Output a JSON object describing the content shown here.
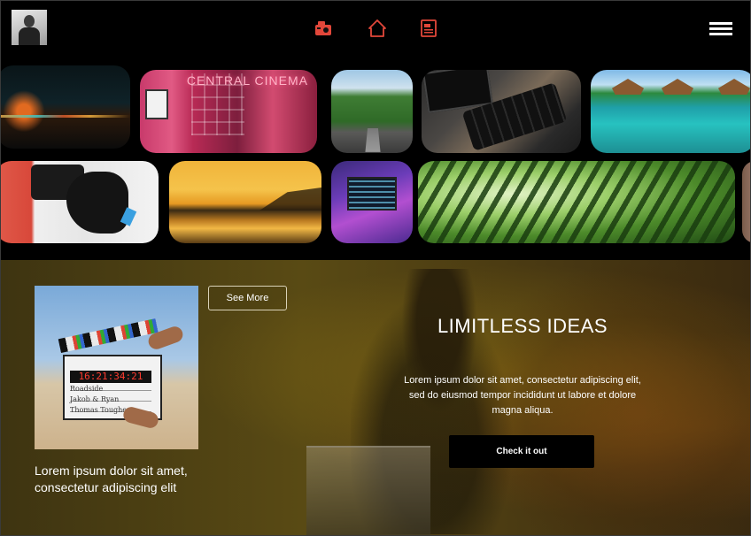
{
  "header": {
    "icons": [
      "camera-icon",
      "home-icon",
      "film-icon",
      "menu-icon"
    ],
    "accent_color": "#e2473a"
  },
  "gallery": {
    "cinema_sign": "CENTRAL CINEMA"
  },
  "hero": {
    "see_more_label": "See More",
    "caption": "Lorem ipsum dolor sit amet, consectetur adipiscing elit",
    "title": "LIMITLESS IDEAS",
    "body": "Lorem ipsum dolor sit amet, consectetur adipiscing elit, sed do eiusmod tempor incididunt ut labore et dolore magna aliqua.",
    "cta_label": "Check it out",
    "clapper": {
      "timecode": "16:21:34:21",
      "line1": "Roadside",
      "line2": "Jakob & Ryan",
      "line3": "Thomas Tougher"
    }
  }
}
